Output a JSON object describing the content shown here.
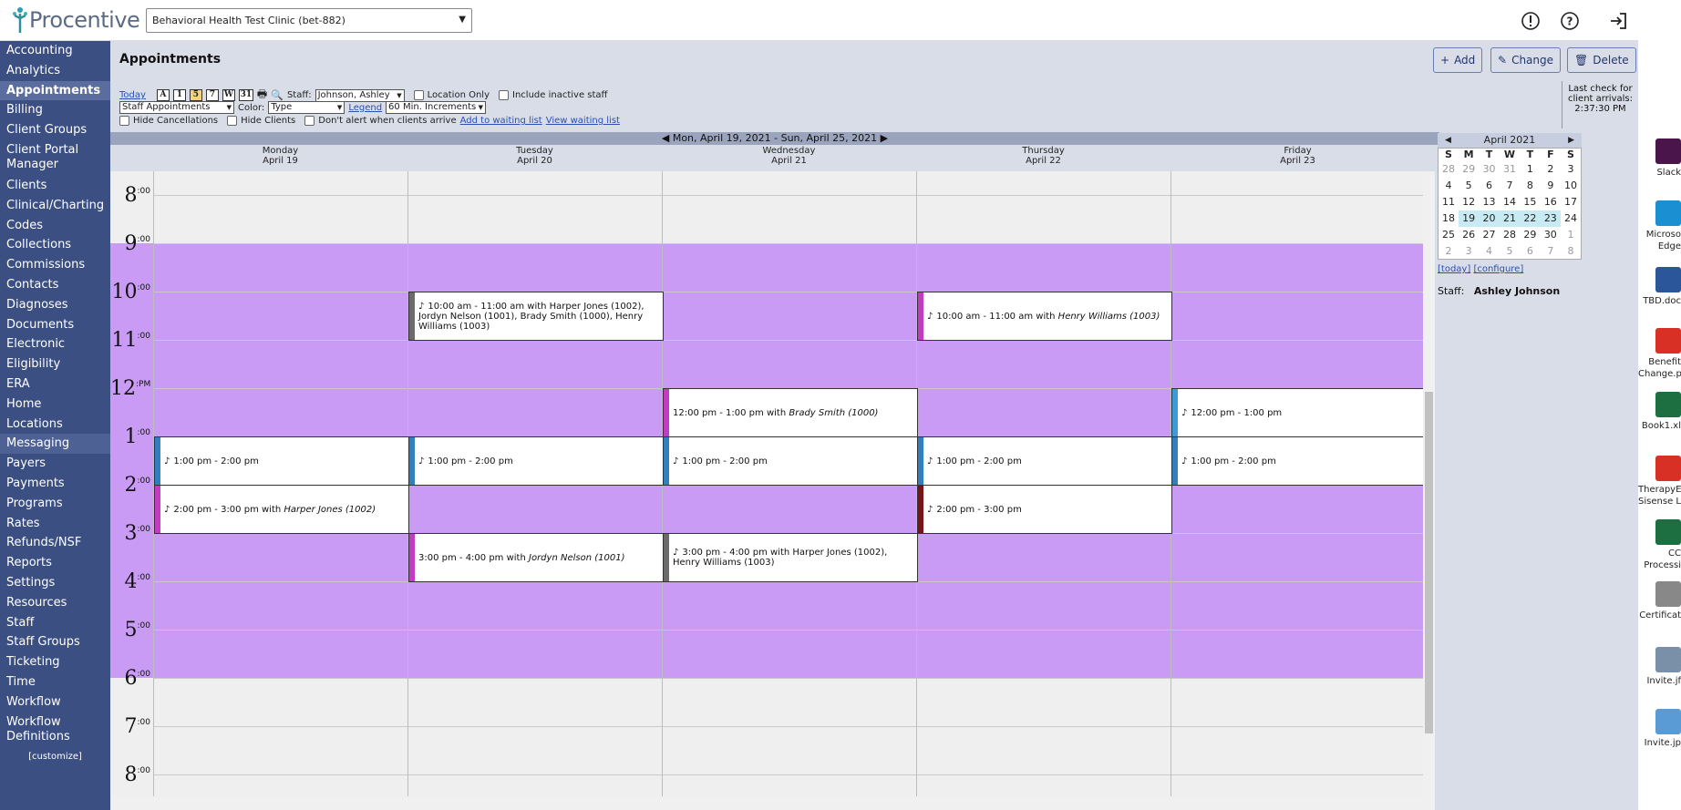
{
  "brand": {
    "name": "Procentive"
  },
  "clinic_select": {
    "value": "Behavioral Health Test Clinic (bet-882)"
  },
  "top_icons": [
    "alert-icon",
    "help-icon",
    "logout-icon"
  ],
  "sidebar": {
    "items": [
      {
        "label": "Accounting"
      },
      {
        "label": "Analytics"
      },
      {
        "label": "Appointments"
      },
      {
        "label": "Billing"
      },
      {
        "label": "Client Groups"
      },
      {
        "label": "Client Portal Manager"
      },
      {
        "label": "Clients"
      },
      {
        "label": "Clinical/Charting"
      },
      {
        "label": "Codes"
      },
      {
        "label": "Collections"
      },
      {
        "label": "Commissions"
      },
      {
        "label": "Contacts"
      },
      {
        "label": "Diagnoses"
      },
      {
        "label": "Documents"
      },
      {
        "label": "Electronic"
      },
      {
        "label": "Eligibility"
      },
      {
        "label": "ERA"
      },
      {
        "label": "Home"
      },
      {
        "label": "Locations"
      },
      {
        "label": "Messaging"
      },
      {
        "label": "Payers"
      },
      {
        "label": "Payments"
      },
      {
        "label": "Programs"
      },
      {
        "label": "Rates"
      },
      {
        "label": "Refunds/NSF"
      },
      {
        "label": "Reports"
      },
      {
        "label": "Settings"
      },
      {
        "label": "Resources"
      },
      {
        "label": "Staff"
      },
      {
        "label": "Staff Groups"
      },
      {
        "label": "Ticketing"
      },
      {
        "label": "Time"
      },
      {
        "label": "Workflow"
      },
      {
        "label": "Workflow Definitions"
      }
    ],
    "customize": "[customize]"
  },
  "page": {
    "title": "Appointments",
    "add_label": "Add",
    "change_label": "Change",
    "delete_label": "Delete"
  },
  "controls": {
    "today": "Today",
    "view_buttons": [
      "A",
      "1",
      "5",
      "7",
      "W",
      "31"
    ],
    "staff_label": "Staff:",
    "staff_value": "Johnson, Ashley",
    "location_only": "Location Only",
    "include_inactive": "Include inactive staff",
    "view_select": "Staff Appointments",
    "color_label": "Color:",
    "color_value": "Type",
    "legend": "Legend",
    "increment_value": "60 Min. Increments",
    "hide_cancellations": "Hide Cancellations",
    "hide_clients": "Hide Clients",
    "dont_alert": "Don't alert when clients arrive",
    "add_waiting": "Add to waiting list",
    "view_waiting": "View waiting list",
    "last_check": "Last check for client arrivals:",
    "last_check_time": "2:37:30 PM"
  },
  "week": {
    "range": "Mon, April 19, 2021 - Sun, April 25, 2021",
    "days": [
      {
        "name": "Monday",
        "date": "April 19"
      },
      {
        "name": "Tuesday",
        "date": "April 20"
      },
      {
        "name": "Wednesday",
        "date": "April 21"
      },
      {
        "name": "Thursday",
        "date": "April 22"
      },
      {
        "name": "Friday",
        "date": "April 23"
      }
    ],
    "hours": [
      {
        "h": "8",
        "m": ":00"
      },
      {
        "h": "9",
        "m": ":00"
      },
      {
        "h": "10",
        "m": ":00"
      },
      {
        "h": "11",
        "m": ":00"
      },
      {
        "h": "12",
        "m": ":PM"
      },
      {
        "h": "1",
        "m": ":00"
      },
      {
        "h": "2",
        "m": ":00"
      },
      {
        "h": "3",
        "m": ":00"
      },
      {
        "h": "4",
        "m": ":00"
      },
      {
        "h": "5",
        "m": ":00"
      },
      {
        "h": "6",
        "m": ":00"
      },
      {
        "h": "7",
        "m": ":00"
      },
      {
        "h": "8",
        "m": ":00"
      }
    ],
    "available_hours": {
      "start": 9,
      "end": 18
    }
  },
  "appointments": [
    {
      "day": 1,
      "start": 10,
      "end": 11,
      "color": "#6b6b6b",
      "icon": true,
      "text": "10:00 am - 11:00 am with Harper Jones (1002), Jordyn Nelson (1001), Brady Smith (1000), Henry Williams (1003)",
      "name": ""
    },
    {
      "day": 3,
      "start": 10,
      "end": 11,
      "color": "#c23bc2",
      "icon": true,
      "text": "10:00 am - 11:00 am with ",
      "name": "Henry Williams (1003)"
    },
    {
      "day": 2,
      "start": 12,
      "end": 13,
      "color": "#c23bc2",
      "icon": false,
      "text": "12:00 pm - 1:00 pm with ",
      "name": "Brady Smith (1000)"
    },
    {
      "day": 4,
      "start": 12,
      "end": 13,
      "color": "#3a9bd6",
      "icon": true,
      "text": "12:00 pm - 1:00 pm",
      "name": ""
    },
    {
      "day": 0,
      "start": 13,
      "end": 14,
      "color": "#2f7fc1",
      "icon": true,
      "text": "1:00 pm - 2:00 pm",
      "name": ""
    },
    {
      "day": 1,
      "start": 13,
      "end": 14,
      "color": "#2f7fc1",
      "icon": true,
      "text": "1:00 pm - 2:00 pm",
      "name": ""
    },
    {
      "day": 2,
      "start": 13,
      "end": 14,
      "color": "#2f7fc1",
      "icon": true,
      "text": "1:00 pm - 2:00 pm",
      "name": ""
    },
    {
      "day": 3,
      "start": 13,
      "end": 14,
      "color": "#2f7fc1",
      "icon": true,
      "text": "1:00 pm - 2:00 pm",
      "name": ""
    },
    {
      "day": 4,
      "start": 13,
      "end": 14,
      "color": "#2f7fc1",
      "icon": true,
      "text": "1:00 pm - 2:00 pm",
      "name": ""
    },
    {
      "day": 0,
      "start": 14,
      "end": 15,
      "color": "#c23bc2",
      "icon": true,
      "text": "2:00 pm - 3:00 pm with ",
      "name": "Harper Jones (1002)"
    },
    {
      "day": 3,
      "start": 14,
      "end": 15,
      "color": "#7a1414",
      "icon": true,
      "text": "2:00 pm - 3:00 pm",
      "name": ""
    },
    {
      "day": 1,
      "start": 15,
      "end": 16,
      "color": "#c23bc2",
      "icon": false,
      "text": "3:00 pm - 4:00 pm with ",
      "name": "Jordyn Nelson (1001)"
    },
    {
      "day": 2,
      "start": 15,
      "end": 16,
      "color": "#6b6b6b",
      "icon": true,
      "text": "3:00 pm - 4:00 pm with Harper Jones (1002), Henry Williams (1003)",
      "name": ""
    }
  ],
  "mini_calendar": {
    "title": "April 2021",
    "dow": [
      "S",
      "M",
      "T",
      "W",
      "T",
      "F",
      "S"
    ],
    "weeks": [
      [
        "28",
        "29",
        "30",
        "31",
        "1",
        "2",
        "3"
      ],
      [
        "4",
        "5",
        "6",
        "7",
        "8",
        "9",
        "10"
      ],
      [
        "11",
        "12",
        "13",
        "14",
        "15",
        "16",
        "17"
      ],
      [
        "18",
        "19",
        "20",
        "21",
        "22",
        "23",
        "24"
      ],
      [
        "25",
        "26",
        "27",
        "28",
        "29",
        "30",
        "1"
      ],
      [
        "2",
        "3",
        "4",
        "5",
        "6",
        "7",
        "8"
      ]
    ],
    "today_link": "[today]",
    "configure_link": "[configure]",
    "staff_label": "Staff:",
    "staff_name": "Ashley Johnson"
  },
  "desktop_icons": [
    {
      "label": "Slack",
      "color": "#4a154b"
    },
    {
      "label": "Microso Edge",
      "color": "#1a8fd1"
    },
    {
      "label": "TBD.doc",
      "color": "#2b579a"
    },
    {
      "label": "Benefit Change.p",
      "color": "#d93025"
    },
    {
      "label": "Book1.xl",
      "color": "#1d6f42"
    },
    {
      "label": "TherapyE Sisense L",
      "color": "#d93025"
    },
    {
      "label": "CC Processi",
      "color": "#1d6f42"
    },
    {
      "label": "Certificat",
      "color": "#888888"
    },
    {
      "label": "Invite.jf",
      "color": "#7a8fa8"
    },
    {
      "label": "Invite.jp",
      "color": "#5b9bd5"
    }
  ]
}
